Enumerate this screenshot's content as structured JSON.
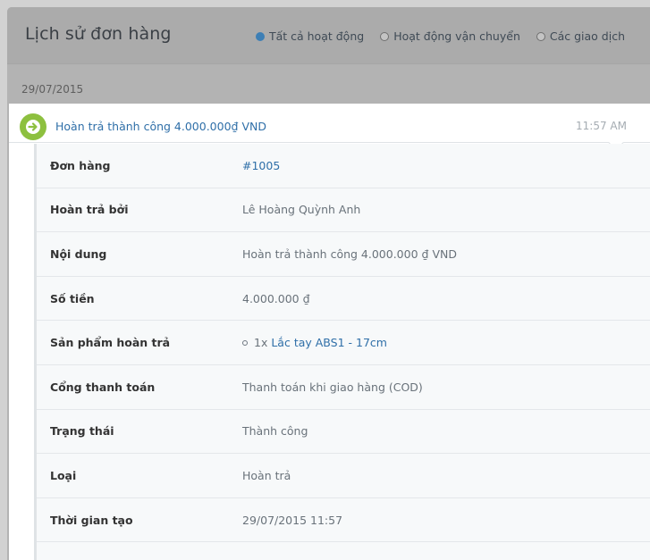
{
  "header": {
    "title": "Lịch sử đơn hàng",
    "filters": [
      {
        "label": "Tất cả hoạt động",
        "checked": true
      },
      {
        "label": "Hoạt động vận chuyển",
        "checked": false
      },
      {
        "label": "Các giao dịch",
        "checked": false
      }
    ]
  },
  "date": "29/07/2015",
  "event": {
    "title": "Hoàn trả thành công 4.000.000₫ VND",
    "time": "11:57 AM",
    "icon": "arrow-right-icon",
    "icon_color": "#8dc03f"
  },
  "details": {
    "order_label": "Đơn hàng",
    "order_value": "#1005",
    "refunded_by_label": "Hoàn trả bởi",
    "refunded_by_value": "Lê Hoàng Quỳnh Anh",
    "content_label": "Nội dung",
    "content_value": "Hoàn trả thành công 4.000.000 ₫  VND",
    "amount_label": "Số tiền",
    "amount_value": "4.000.000 ₫",
    "products_label": "Sản phẩm hoàn trả",
    "product_qty": "1x ",
    "product_name": "Lắc tay ABS1 - 17cm",
    "gateway_label": "Cổng thanh toán",
    "gateway_value": "Thanh toán khi giao hàng (COD)",
    "status_label": "Trạng thái",
    "status_value": "Thành công",
    "type_label": "Loại",
    "type_value": "Hoàn trả",
    "created_label": "Thời gian tạo",
    "created_value": "29/07/2015 11:57"
  },
  "colors": {
    "accent": "#2f6fa8",
    "success": "#8dc03f",
    "overlay": "#b3b3b3"
  }
}
